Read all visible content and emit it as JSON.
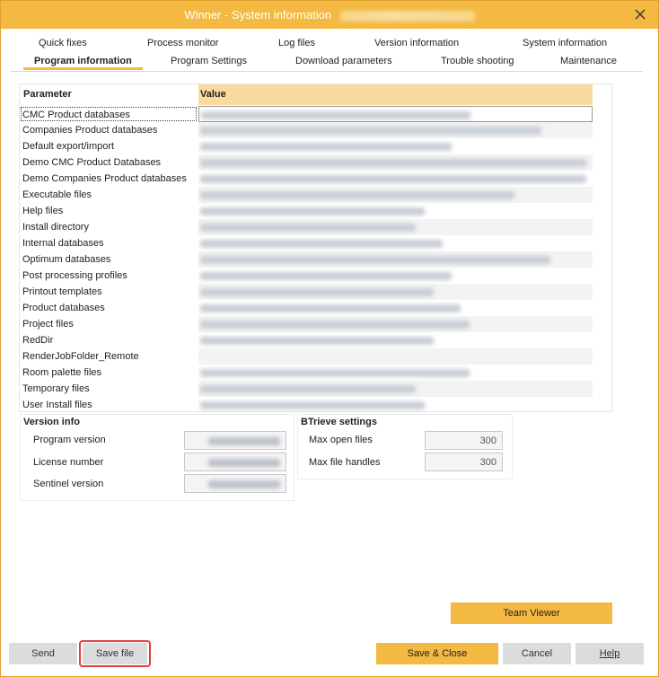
{
  "window": {
    "title": "Winner - System information"
  },
  "tabs_row1": [
    "Quick fixes",
    "Process monitor",
    "Log files",
    "Version information",
    "System information"
  ],
  "tabs_row2": [
    "Program information",
    "Program Settings",
    "Download parameters",
    "Trouble shooting",
    "Maintenance"
  ],
  "grid": {
    "header_param": "Parameter",
    "header_value": "Value",
    "rows": [
      "CMC Product databases",
      "Companies Product databases",
      "Default export/import",
      "Demo CMC Product Databases",
      "Demo Companies Product databases",
      "Executable files",
      "Help files",
      "Install directory",
      "Internal databases",
      "Optimum databases",
      "Post processing profiles",
      "Printout templates",
      "Product databases",
      "Project files",
      "RedDir",
      "RenderJobFolder_Remote",
      "Room palette files",
      "Temporary files",
      "User Install files"
    ]
  },
  "version_info": {
    "title": "Version info",
    "program_version_label": "Program version",
    "license_number_label": "License number",
    "sentinel_version_label": "Sentinel version"
  },
  "btrieve": {
    "title": "BTrieve settings",
    "max_open_files_label": "Max open files",
    "max_open_files_value": "300",
    "max_file_handles_label": "Max file handles",
    "max_file_handles_value": "300"
  },
  "buttons": {
    "team_viewer": "Team Viewer",
    "send": "Send",
    "save_file": "Save file",
    "save_close": "Save & Close",
    "cancel": "Cancel",
    "help": "Help"
  },
  "colors": {
    "accent": "#f4b942",
    "highlight": "#e04040",
    "header_bg": "#f9dba0"
  }
}
